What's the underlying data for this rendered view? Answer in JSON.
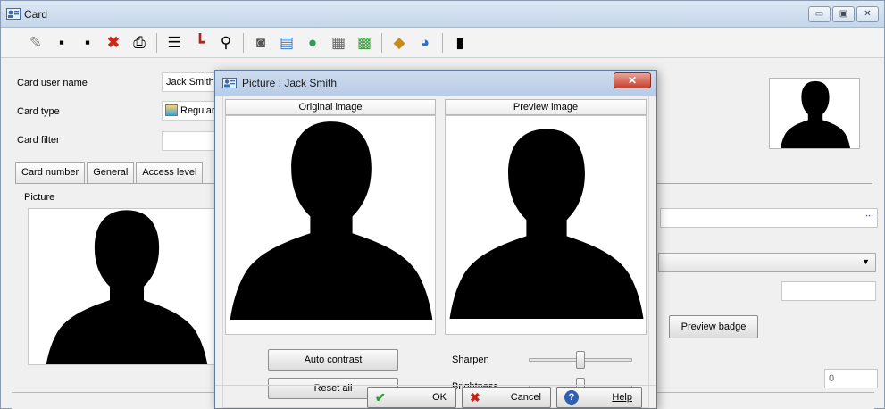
{
  "window": {
    "title": "Card"
  },
  "form": {
    "card_user_name_label": "Card user name",
    "card_user_name_value": "Jack Smith",
    "card_type_label": "Card type",
    "card_type_value": "Regular",
    "card_filter_label": "Card filter",
    "tabs": [
      "Card number",
      "General",
      "Access level"
    ],
    "picture_label": "Picture",
    "preview_badge_label": "Preview badge",
    "number_field_value": "0"
  },
  "dialog": {
    "title": "Picture : Jack Smith",
    "original_header": "Original image",
    "preview_header": "Preview image",
    "auto_contrast_label": "Auto contrast",
    "reset_all_label": "Reset all",
    "sharpen_label": "Sharpen",
    "brightness_label": "Brightness",
    "sharpen_value": 0.5,
    "brightness_value": 0.5,
    "ok_label": "OK",
    "cancel_label": "Cancel",
    "help_label": "Help"
  },
  "colors": {
    "titlebar": "#c5d6ea",
    "close_red": "#c7412e",
    "ok_green": "#2e9c2e",
    "cancel_red": "#c8231a",
    "help_blue": "#2f5fb3"
  }
}
